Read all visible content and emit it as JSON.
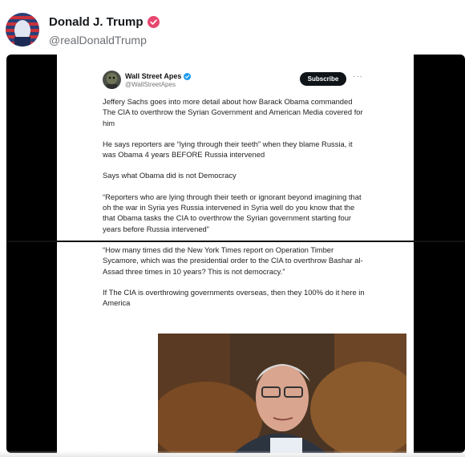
{
  "post": {
    "author_name": "Donald J. Trump",
    "author_handle": "@realDonaldTrump",
    "verified_badge_color": "#e8466e"
  },
  "embedded_tweet": {
    "account_name": "Wall Street Apes",
    "account_handle": "@WallStreetApes",
    "subscribe_label": "Subscribe",
    "more_label": "···",
    "paragraphs": [
      "Jeffery Sachs goes into more detail about how Barack Obama commanded The CIA to overthrow the Syrian Government and American Media covered for him",
      "He says reporters are “lying through their teeth” when they blame Russia, it was Obama 4 years BEFORE Russia intervened",
      "Says what Obama did is not Democracy",
      "“Reporters who are lying through their teeth or ignorant beyond imagining that oh the war in Syria yes Russia intervened in Syria well do you know that the that Obama tasks the CIA to overthrow the Syrian government starting four years before Russia intervened”",
      "“How many times did the New York Times report on Operation Timber Sycamore, which was the presidential order to the CIA to overthrow Bashar al-Assad three times in 10 years? This is not democracy.”",
      "If The CIA is overthrowing governments overseas, then they 100% do it here in America"
    ]
  }
}
